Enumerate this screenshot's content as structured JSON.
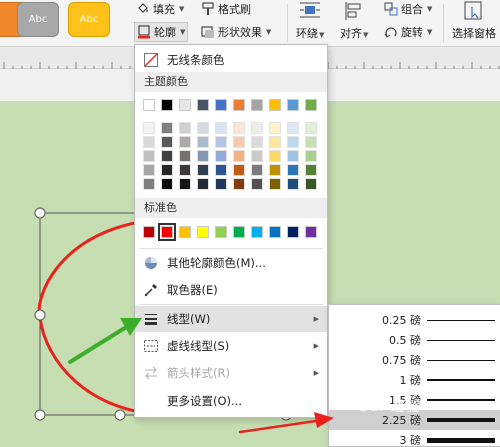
{
  "ribbon": {
    "style_swatches": [
      {
        "label": "",
        "color": "#f0872a"
      },
      {
        "label": "Abc",
        "color": "#a8a8a8"
      },
      {
        "label": "Abc",
        "color": "#ffc21a"
      }
    ],
    "fill_label": "填充",
    "format_painter_label": "格式刷",
    "outline_label": "轮廓",
    "shape_effect_label": "形状效果",
    "wrap_label": "环绕",
    "align_label": "对齐",
    "group_label": "组合",
    "rotate_label": "旋转",
    "selection_pane_label": "选择窗格"
  },
  "outline_menu": {
    "no_line": "无线条颜色",
    "theme_colors_title": "主题颜色",
    "theme_top_row": [
      "#ffffff",
      "#000000",
      "#e7e6e6",
      "#44546a",
      "#4472c4",
      "#ed7d31",
      "#a5a5a5",
      "#ffc000",
      "#5b9bd5",
      "#70ad47"
    ],
    "theme_shade_rows": [
      [
        "#f2f2f2",
        "#7f7f7f",
        "#d0cece",
        "#d6dce4",
        "#dae3f3",
        "#fbe5d6",
        "#ededed",
        "#fff2cc",
        "#deebf7",
        "#e2f0d9"
      ],
      [
        "#d9d9d9",
        "#595959",
        "#aeaaaa",
        "#adb9ca",
        "#b4c7e7",
        "#f8cbad",
        "#dbdbdb",
        "#ffe699",
        "#bdd7ee",
        "#c5e0b4"
      ],
      [
        "#bfbfbf",
        "#404040",
        "#757171",
        "#8497b0",
        "#8faadc",
        "#f4b183",
        "#c9c9c9",
        "#ffd966",
        "#9dc3e6",
        "#a9d18e"
      ],
      [
        "#a6a6a6",
        "#262626",
        "#3a3838",
        "#333f50",
        "#2f5597",
        "#c55a11",
        "#7b7b7b",
        "#bf9000",
        "#2e75b6",
        "#548235"
      ],
      [
        "#7f7f7f",
        "#0d0d0d",
        "#171616",
        "#222a35",
        "#203864",
        "#843c0c",
        "#525252",
        "#7f6000",
        "#1f4e79",
        "#385723"
      ]
    ],
    "standard_colors_title": "标准色",
    "standard_colors": [
      "#c00000",
      "#ff0000",
      "#ffc000",
      "#ffff00",
      "#92d050",
      "#00b050",
      "#00b0f0",
      "#0070c0",
      "#002060",
      "#7030a0"
    ],
    "selected_standard_color": "#ff0000",
    "more_colors": "其他轮廓颜色(M)...",
    "eyedropper": "取色器(E)",
    "line_type": "线型(W)",
    "dash_type": "虚线线型(S)",
    "arrow_style": "箭头样式(R)",
    "more_settings": "更多设置(O)..."
  },
  "line_weight_menu": {
    "items": [
      {
        "label": "0.25 磅",
        "weight": 0.25
      },
      {
        "label": "0.5 磅",
        "weight": 0.5
      },
      {
        "label": "0.75 磅",
        "weight": 0.75
      },
      {
        "label": "1 磅",
        "weight": 1
      },
      {
        "label": "1.5 磅",
        "weight": 1.5
      },
      {
        "label": "2.25 磅",
        "weight": 2.25
      },
      {
        "label": "3 磅",
        "weight": 3
      }
    ],
    "selected_item": "2.25 磅"
  },
  "watermark": "Bai 经验",
  "colors": {
    "canvas": "#c6deb2",
    "shape_outline": "#e8231f",
    "annotation_arrow": "#3dae2b",
    "annotation_arrow_red": "#e8231f"
  }
}
